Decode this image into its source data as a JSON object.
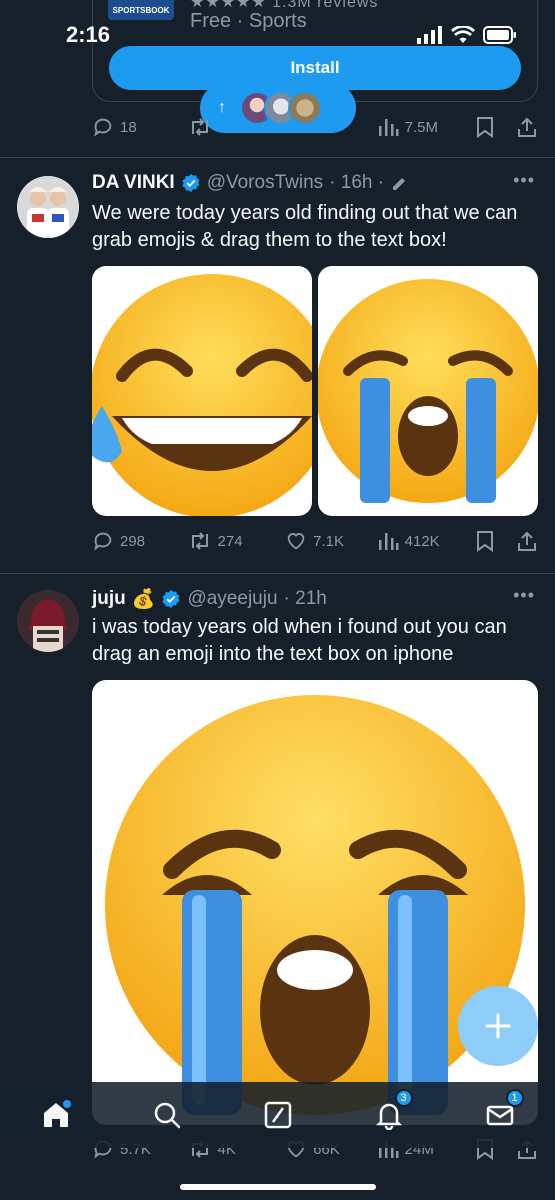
{
  "status": {
    "time": "2:16"
  },
  "ad": {
    "logo_text": "SPORTSBOOK",
    "rating_text": "★★★★★ 1.3M reviews",
    "subtitle": "Free · Sports",
    "install_label": "Install",
    "stats": {
      "replies": "18",
      "views": "7.5M"
    }
  },
  "new_posts": {
    "arrow": "↑"
  },
  "tweets": [
    {
      "name": "DA VINKI",
      "handle": "@VorosTwins",
      "time": "· 16h ·",
      "text": "We were today years old finding out that we can grab emojis & drag them to the text box!",
      "stats": {
        "replies": "298",
        "retweets": "274",
        "likes": "7.1K",
        "views": "412K"
      }
    },
    {
      "name": "juju",
      "name_emoji": "💰",
      "handle": "@ayeejuju",
      "time": "· 21h",
      "text": "i was today years old when i found out you can drag an emoji into the text box on iphone",
      "stats": {
        "replies": "5.7K",
        "retweets": "4K",
        "likes": "66K",
        "views": "24M"
      }
    }
  ],
  "nav": {
    "notifications_badge": "3",
    "messages_badge": "1"
  },
  "colors": {
    "accent": "#1d9bf0",
    "background": "#15202b",
    "muted": "#8b98a5"
  }
}
